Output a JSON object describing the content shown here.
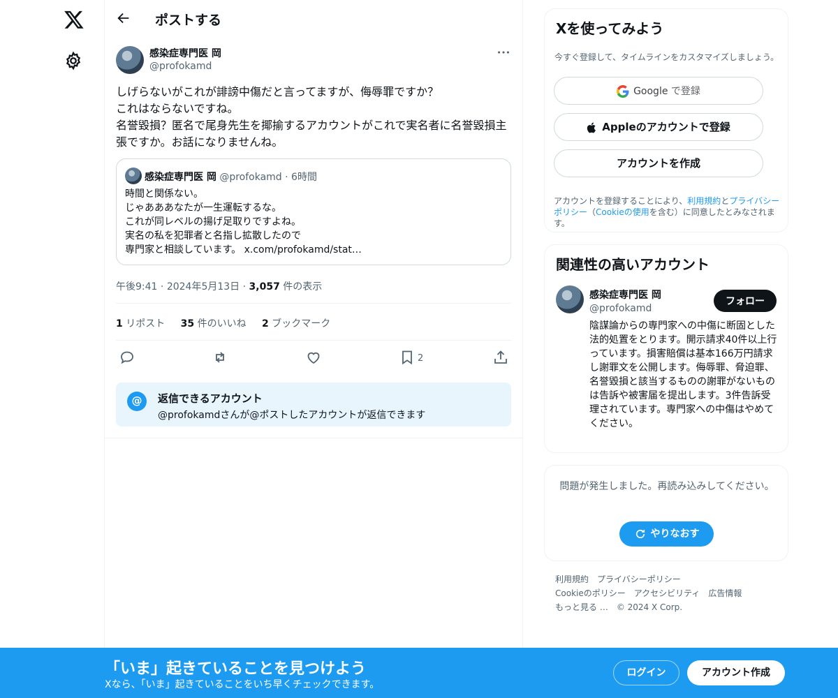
{
  "header": {
    "title": "ポストする"
  },
  "post": {
    "author_name": "感染症専門医 岡",
    "author_handle": "@profokamd",
    "text": "しげらないがこれが誹謗中傷だと言ってますが、侮辱罪ですか？\nこれはならないですね。\n名誉毀損？匿名で尾身先生を揶揄するアカウントがこれで実名者に名誉毀損主張ですか。お話になりませんね。",
    "quote": {
      "author_name": "感染症専門医 岡",
      "author_handle": "@profokamd",
      "separator": "·",
      "time": "6時間",
      "text": "時間と関係ない。\nじゃあああなたが一生運転するな。\nこれが同レベルの揚げ足取りですよね。\n実名の私を犯罪者と名指し拡散したので\n専門家と相談しています。 x.com/profokamd/stat…"
    },
    "time": "午後9:41",
    "date": "2024年5月13日",
    "views_count": "3,057",
    "views_label": "件の表示",
    "reposts_count": "1",
    "reposts_label": "リポスト",
    "likes_count": "35",
    "likes_label": "件のいいね",
    "bookmarks_count": "2",
    "bookmarks_label": "ブックマーク",
    "action_bookmark_count": "2"
  },
  "reply_restriction": {
    "icon": "@",
    "title": "返信できるアカウント",
    "subtitle": "@profokamdさんが@ポストしたアカウントが返信できます"
  },
  "signup_card": {
    "title": "Xを使ってみよう",
    "subtitle": "今すぐ登録して、タイムラインをカスタマイズしましょう。",
    "google_brand": "Google",
    "google_suffix": " で登録",
    "apple_label": "Appleのアカウントで登録",
    "create_label": "アカウントを作成",
    "legal_1": "アカウントを登録することにより、",
    "legal_terms": "利用規約",
    "legal_and": "と",
    "legal_privacy": "プライバシーポリシー",
    "legal_2": "（",
    "legal_cookie": "Cookieの使用",
    "legal_3": "を含む）に同意したとみなされます。"
  },
  "recommended": {
    "title": "関連性の高いアカウント",
    "name": "感染症専門医 岡",
    "handle": "@profokamd",
    "follow_label": "フォロー",
    "bio": "陰謀論からの専門家への中傷に断固とした法的処置をとります。開示請求40件以上行っています。損害賠償は基本166万円請求し謝罪文を公開します。侮辱罪、脅迫罪、名誉毀損と該当するものの謝罪がないものは告訴や被害届を提出します。3件告訴受理されています。専門家への中傷はやめてください。"
  },
  "error_card": {
    "message": "問題が発生しました。再読み込みしてください。",
    "retry_label": "やりなおす"
  },
  "footer": {
    "links": [
      "利用規約",
      "プライバシーポリシー",
      "Cookieのポリシー",
      "アクセシビリティ",
      "広告情報",
      "もっと見る …",
      "© 2024 X Corp."
    ]
  },
  "bottom_bar": {
    "title": "「いま」起きていることを見つけよう",
    "subtitle": "Xなら、「いま」起きていることをいち早くチェックできます。",
    "login_label": "ログイン",
    "signup_label": "アカウント作成"
  },
  "colors": {
    "accent": "#1d9bf0",
    "text": "#0f1419",
    "muted": "#536471"
  }
}
